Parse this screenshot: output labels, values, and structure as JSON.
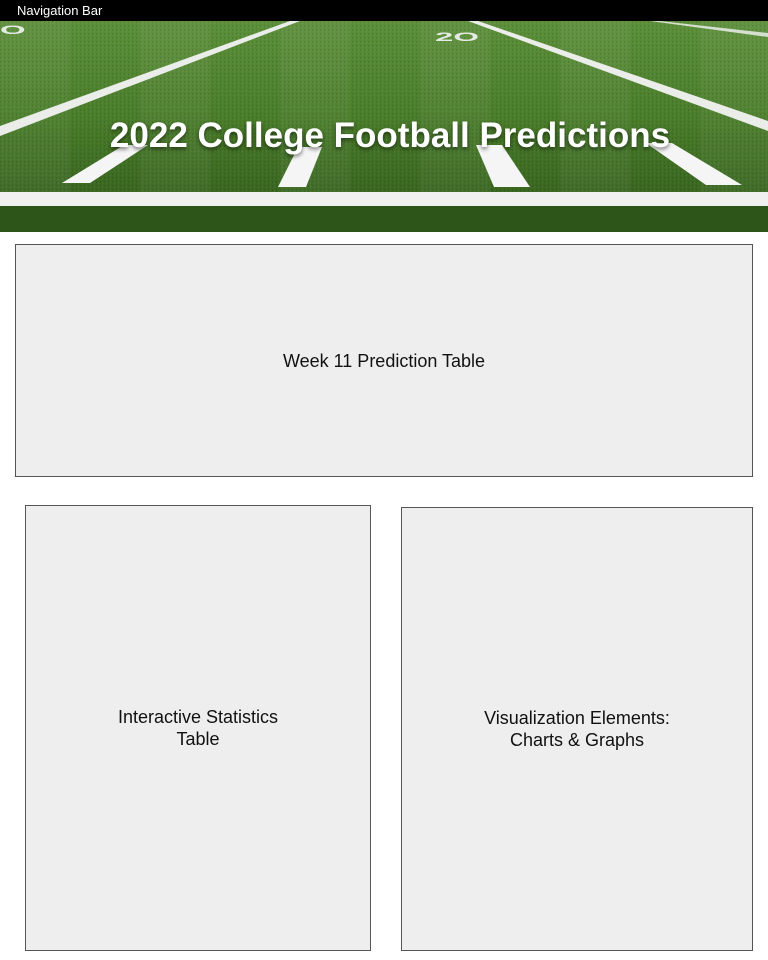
{
  "nav": {
    "label": "Navigation Bar"
  },
  "hero": {
    "title": "2022 College Football Predictions",
    "image_alt": "football field"
  },
  "panels": {
    "predictions": "Week 11 Prediction Table",
    "statistics": "Interactive Statistics\nTable",
    "visualization": "Visualization Elements:\nCharts & Graphs"
  },
  "colors": {
    "nav_bg": "#000000",
    "panel_bg": "#eeeeee",
    "panel_border": "#555555",
    "turf": "#4a7a2c"
  }
}
